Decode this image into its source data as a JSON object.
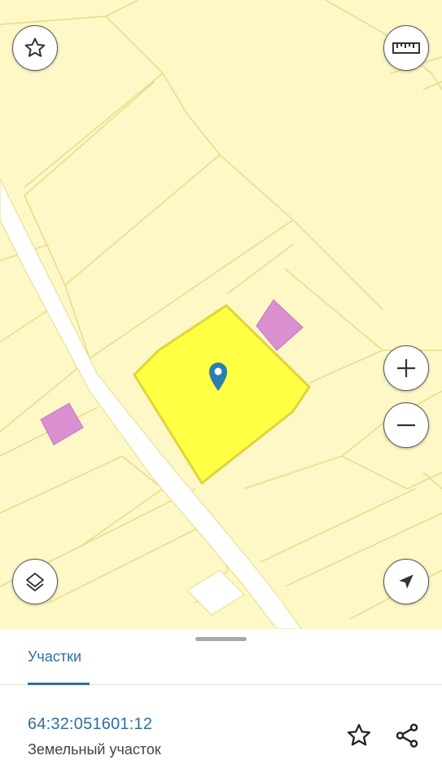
{
  "map": {
    "background_color": "#fdf8c5",
    "parcel_color": "#ffff44",
    "building_color": "#d98fd0",
    "road_color": "#ffffff",
    "controls": {
      "favorite": "star-outline-icon",
      "ruler": "ruler-icon",
      "zoom_in": "plus-icon",
      "zoom_out": "minus-icon",
      "layers": "layers-icon",
      "locate": "navigation-arrow-icon"
    }
  },
  "sheet": {
    "tab_label": "Участки",
    "cadastral_number": "64:32:051601:12",
    "object_type": "Земельный участок",
    "accent_color": "#2f6f9f"
  }
}
